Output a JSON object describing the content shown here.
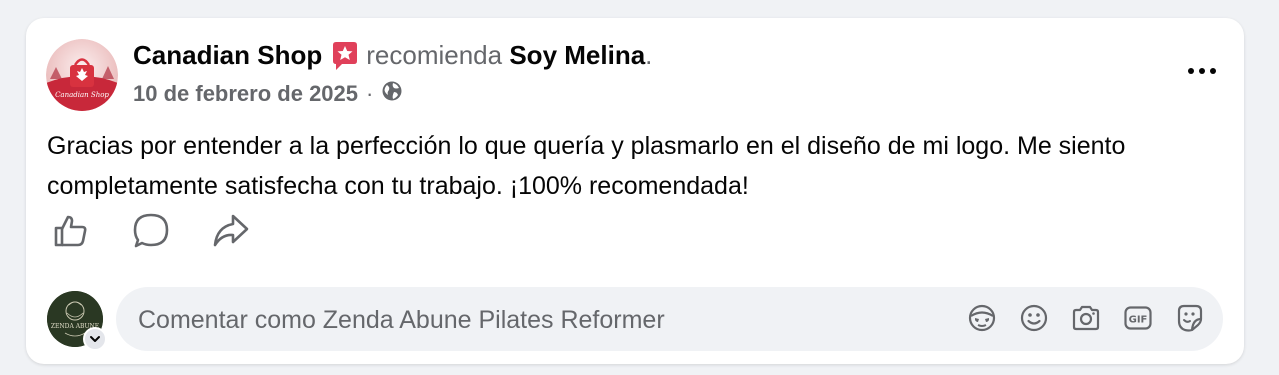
{
  "post": {
    "author": "Canadian Shop",
    "verb": "recomienda",
    "page": "Soy Melina",
    "period": ".",
    "date": "10 de febrero de 2025",
    "separator": "·",
    "text": "Gracias por entender a la perfección lo que quería y plasmarlo en el diseño de mi logo. Me siento completamente satisfecha con tu trabajo. ¡100% recomendada!",
    "avatar_logo_text": "Canadian Shop"
  },
  "actions": {
    "like_icon": "thumbs-up-icon",
    "comment_icon": "comment-bubble-icon",
    "share_icon": "share-arrow-icon"
  },
  "comment": {
    "placeholder": "Comentar como Zenda Abune Pilates Reformer",
    "avatar_logo_text": "ZENDA ABUNE",
    "icons": [
      "avatar-sticker-icon",
      "emoji-icon",
      "camera-icon",
      "gif-icon",
      "sticker-icon"
    ],
    "gif_label": "GIF"
  },
  "colors": {
    "background": "#f0f2f5",
    "card": "#ffffff",
    "text": "#050505",
    "muted": "#65676b",
    "recommend_badge": "#e0405a"
  }
}
